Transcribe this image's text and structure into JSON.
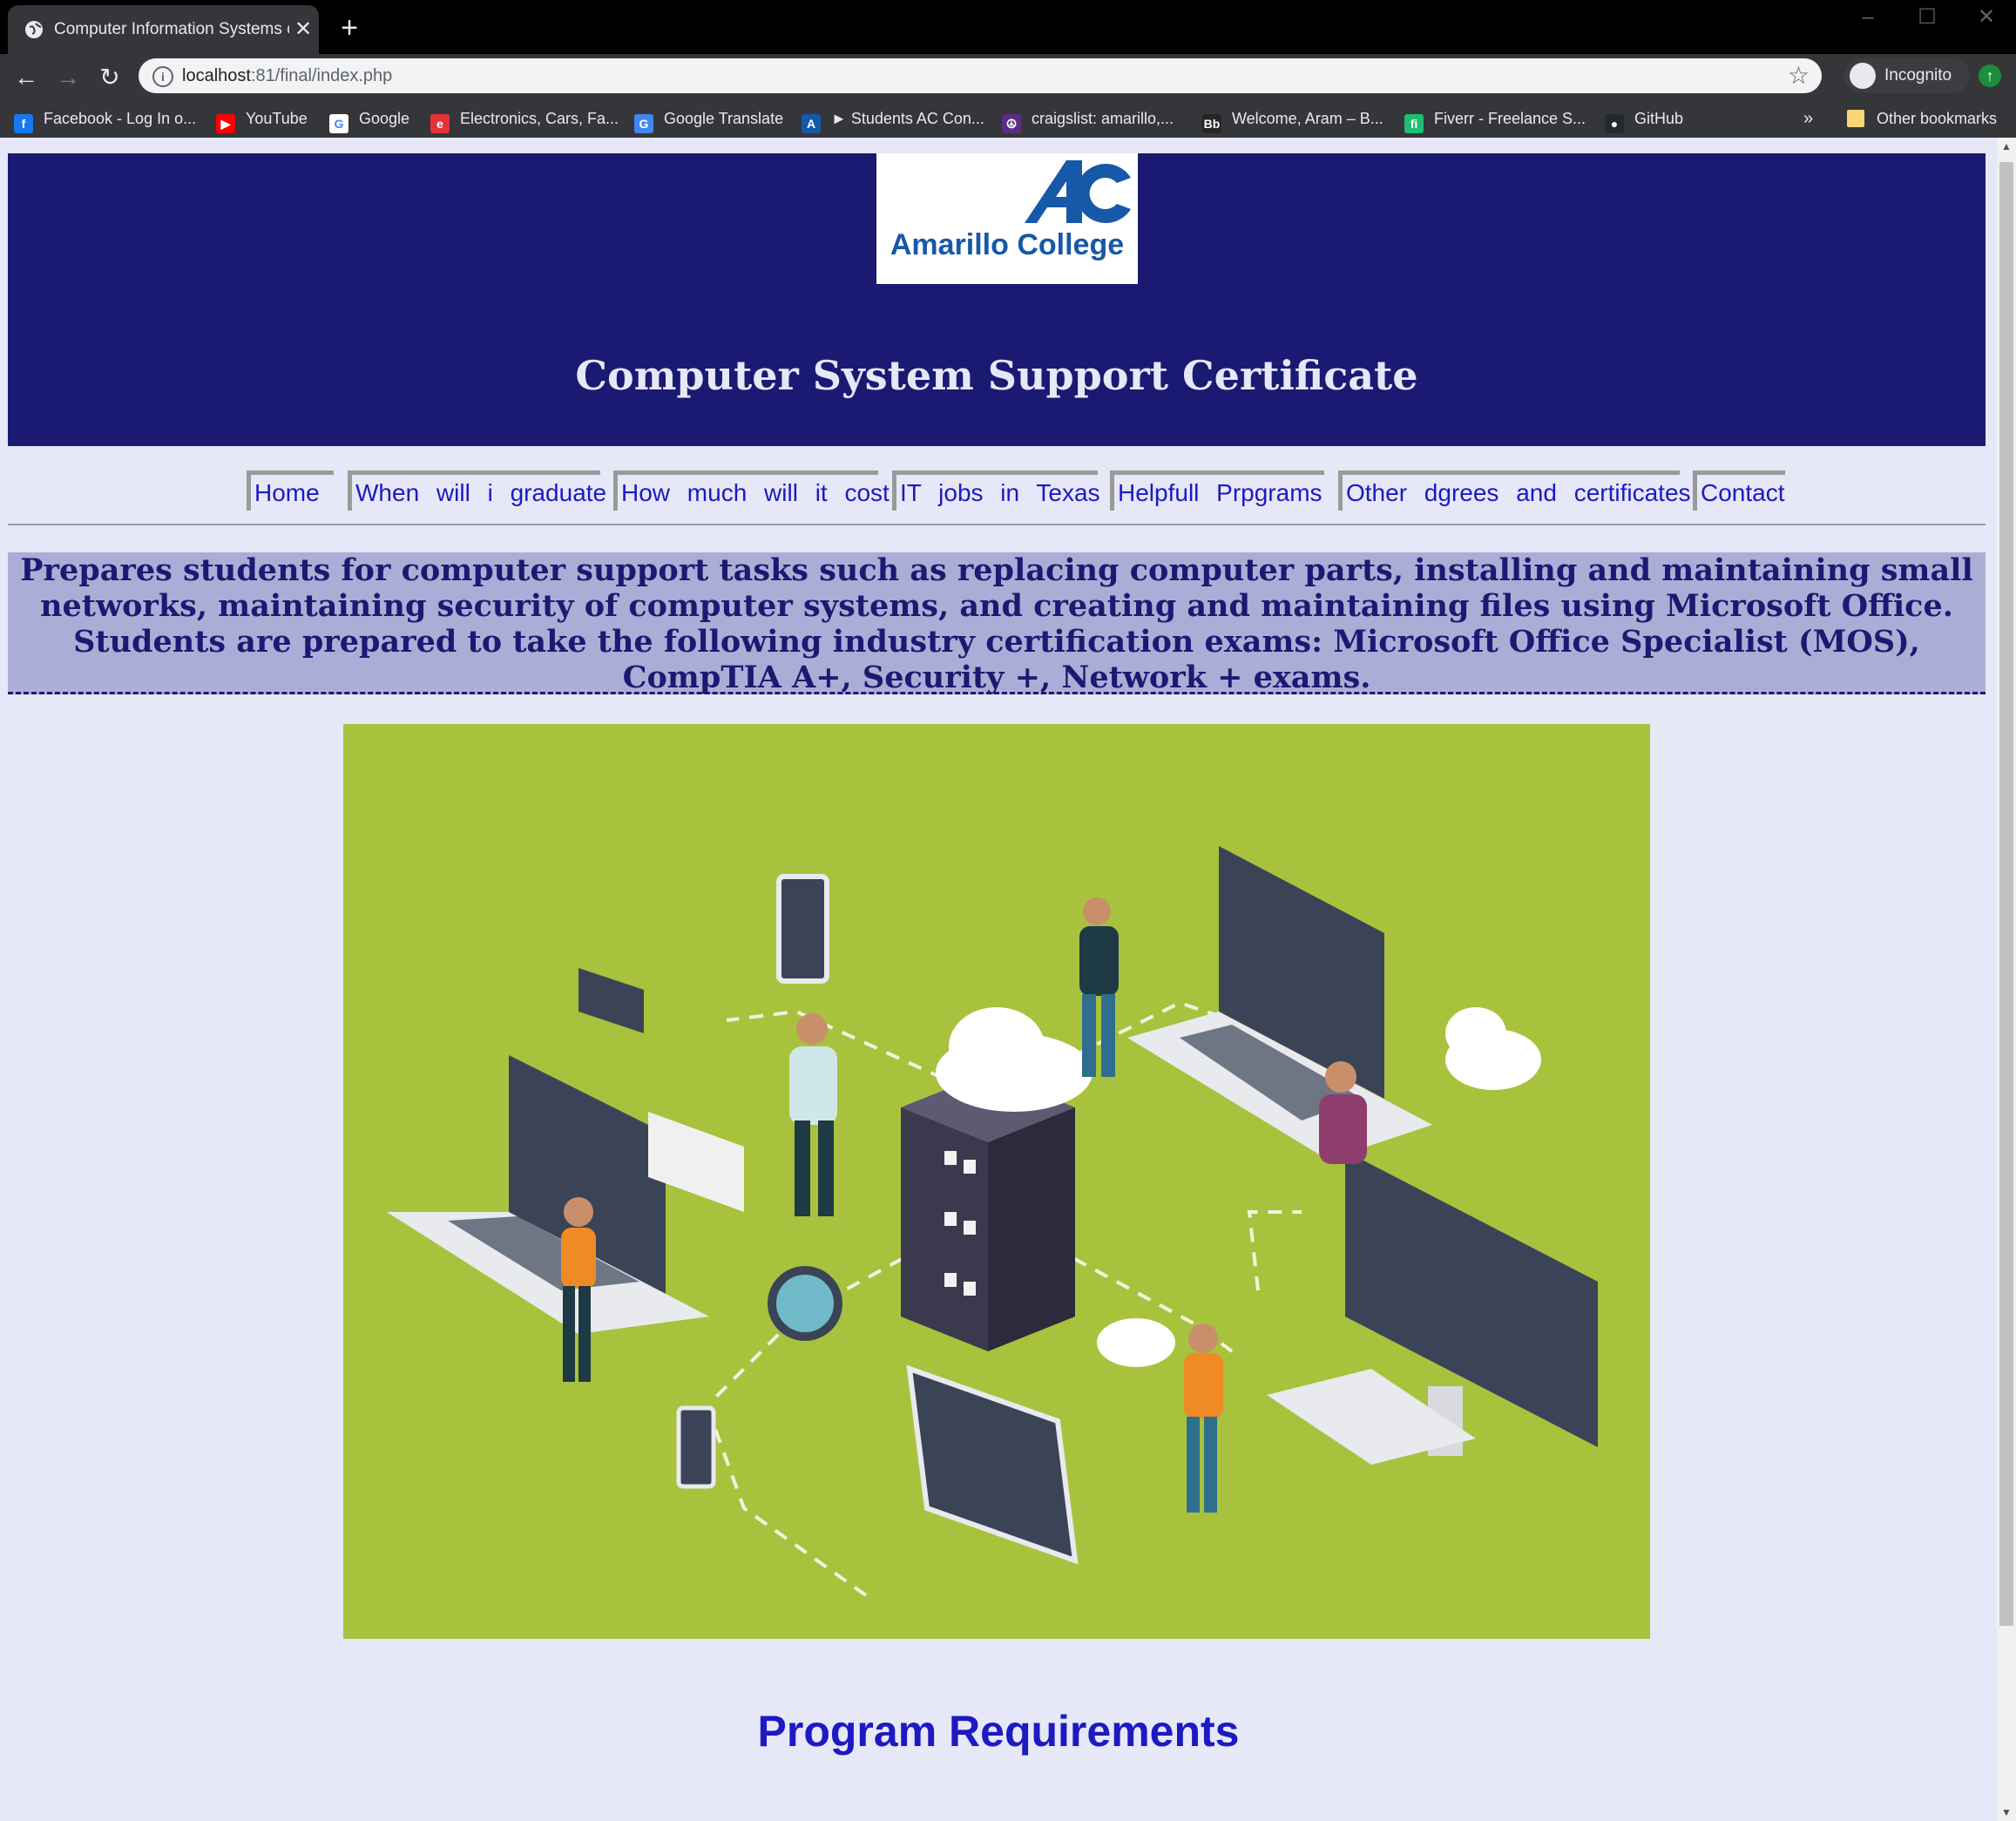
{
  "browser": {
    "tab_title": "Computer Information Systems c",
    "url_host": "localhost",
    "url_rest": ":81/final/index.php",
    "incognito_label": "Incognito",
    "bookmarks": [
      {
        "label": "Facebook - Log In o...",
        "icon": "facebook-icon",
        "color": "#1877f2"
      },
      {
        "label": "YouTube",
        "icon": "youtube-icon",
        "color": "#ff0000"
      },
      {
        "label": "Google",
        "icon": "google-icon",
        "color": "#ffffff"
      },
      {
        "label": "Electronics, Cars, Fa...",
        "icon": "ebay-icon",
        "color": "#e53238"
      },
      {
        "label": "Google Translate",
        "icon": "translate-icon",
        "color": "#4285f4"
      },
      {
        "label": "► Students AC Con...",
        "icon": "ac-icon",
        "color": "#1559a8"
      },
      {
        "label": "craigslist: amarillo,...",
        "icon": "craigslist-icon",
        "color": "#5a2d82"
      },
      {
        "label": "Welcome, Aram – B...",
        "icon": "blackboard-icon",
        "color": "#262626"
      },
      {
        "label": "Fiverr - Freelance S...",
        "icon": "fiverr-icon",
        "color": "#1dbf73"
      },
      {
        "label": "GitHub",
        "icon": "github-icon",
        "color": "#24292e"
      }
    ],
    "other_bookmarks": "Other bookmarks"
  },
  "page": {
    "logo_text": "Amarillo College",
    "title": "Computer System Support Certificate",
    "nav": [
      "Home",
      "When will i graduate",
      "How much will it cost",
      "IT jobs in Texas",
      "Helpfull Prpgrams",
      "Other dgrees and certificates",
      "Contact"
    ],
    "intro": "Prepares students for computer support tasks such as replacing computer parts, installing and maintaining small networks, maintaining security of computer systems, and creating and maintaining files using Microsoft Office. Students are prepared to take the following industry certification exams: Microsoft Office Specialist (MOS), CompTIA A+, Security +, Network + exams.",
    "section_title": "Program Requirements"
  },
  "colors": {
    "header_bg": "#1b1a72",
    "link": "#1c1ac0",
    "page_bg": "#e6e7f7",
    "intro_bg": "#acadd6",
    "hero_bg": "#a8c23e"
  }
}
